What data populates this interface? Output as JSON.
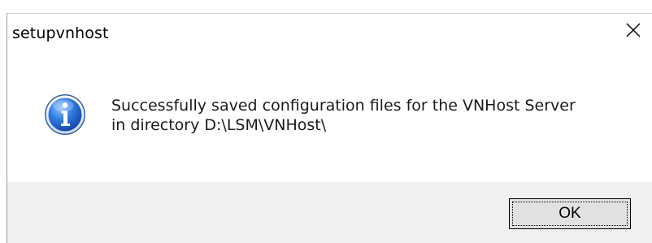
{
  "window": {
    "title": "setupvnhost"
  },
  "message": {
    "line1": "Successfully saved configuration files for the VNHost Server",
    "line2": "in directory D:\\LSM\\VNHost\\"
  },
  "icons": {
    "message_icon": "information-icon",
    "close_icon": "close-icon"
  },
  "buttons": {
    "ok_label": "OK"
  },
  "colors": {
    "footer_background": "#f0f0f0",
    "button_background": "#e1e1e1",
    "info_icon_blue": "#1f5fc8"
  }
}
